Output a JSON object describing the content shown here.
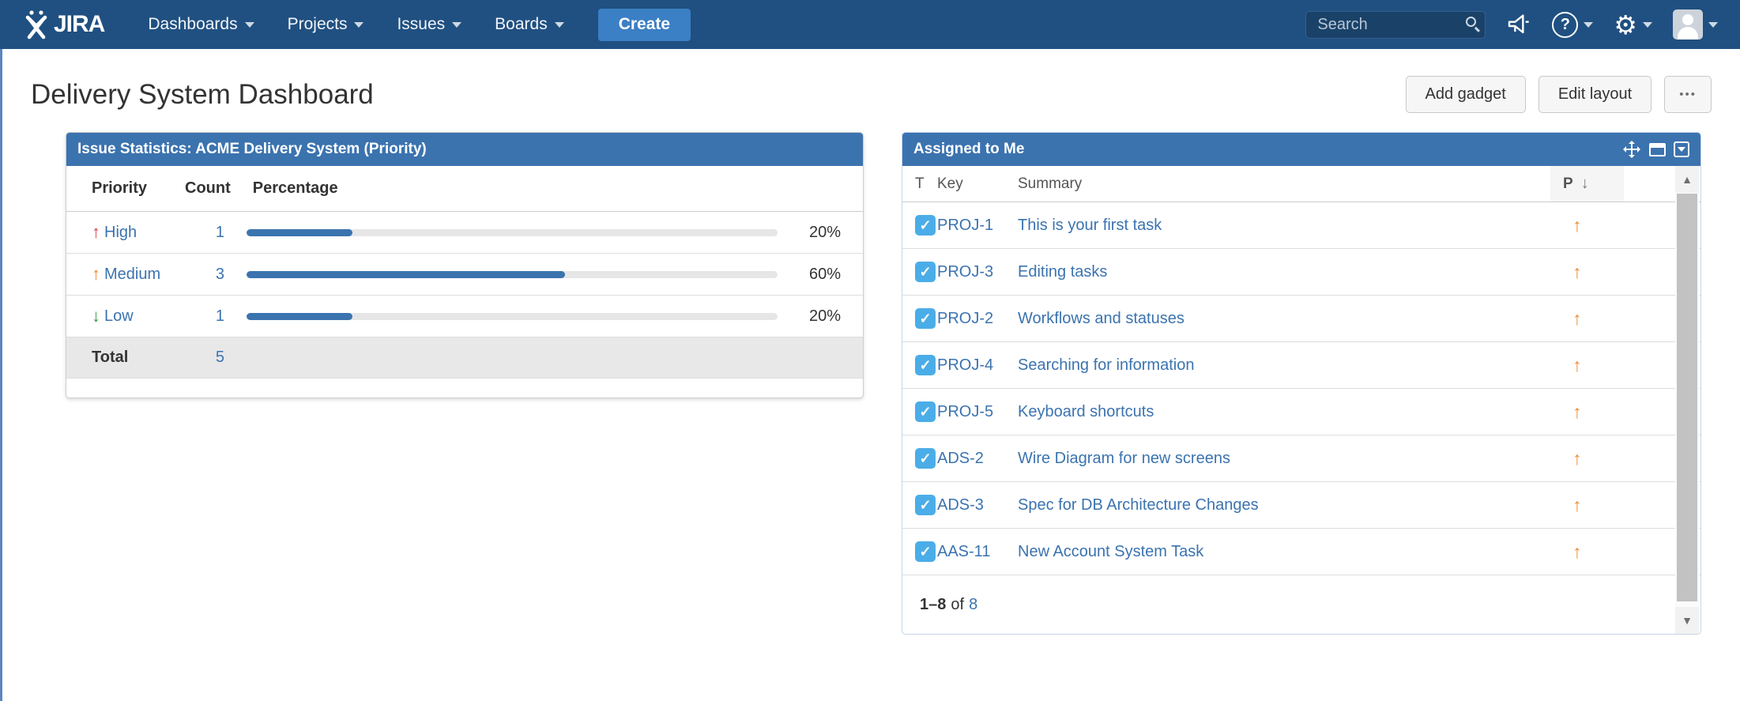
{
  "nav": {
    "logo_text": "JIRA",
    "items": [
      {
        "label": "Dashboards"
      },
      {
        "label": "Projects"
      },
      {
        "label": "Issues"
      },
      {
        "label": "Boards"
      }
    ],
    "create_label": "Create",
    "search_placeholder": "Search"
  },
  "icons": {
    "help": "?",
    "gear": "⚙",
    "check": "✓",
    "scroll_up": "▲",
    "scroll_down": "▼"
  },
  "page": {
    "title": "Delivery System Dashboard",
    "actions": {
      "add_gadget": "Add gadget",
      "edit_layout": "Edit layout",
      "more": "•••"
    }
  },
  "issue_stats": {
    "title": "Issue Statistics: ACME Delivery System (Priority)",
    "columns": [
      "Priority",
      "Count",
      "Percentage"
    ],
    "rows": [
      {
        "priority": "High",
        "arrow": "↑",
        "arrow_color": "#d5484a",
        "count": "1",
        "pct": 20,
        "pct_label": "20%"
      },
      {
        "priority": "Medium",
        "arrow": "↑",
        "arrow_color": "#ef8b31",
        "count": "3",
        "pct": 60,
        "pct_label": "60%"
      },
      {
        "priority": "Low",
        "arrow": "↓",
        "arrow_color": "#3e9b44",
        "count": "1",
        "pct": 20,
        "pct_label": "20%"
      }
    ],
    "total_label": "Total",
    "total_value": "5"
  },
  "assigned": {
    "title": "Assigned to Me",
    "columns": {
      "t": "T",
      "key": "Key",
      "summary": "Summary",
      "p": "P"
    },
    "sort_arrow": "↓",
    "rows": [
      {
        "key": "PROJ-1",
        "summary": "This is your first task",
        "priority_arrow": "↑"
      },
      {
        "key": "PROJ-3",
        "summary": "Editing tasks",
        "priority_arrow": "↑"
      },
      {
        "key": "PROJ-2",
        "summary": "Workflows and statuses",
        "priority_arrow": "↑"
      },
      {
        "key": "PROJ-4",
        "summary": "Searching for information",
        "priority_arrow": "↑"
      },
      {
        "key": "PROJ-5",
        "summary": "Keyboard shortcuts",
        "priority_arrow": "↑"
      },
      {
        "key": "ADS-2",
        "summary": "Wire Diagram for new screens",
        "priority_arrow": "↑"
      },
      {
        "key": "ADS-3",
        "summary": "Spec for DB Architecture Changes",
        "priority_arrow": "↑"
      },
      {
        "key": "AAS-11",
        "summary": "New Account System Task",
        "priority_arrow": "↑"
      }
    ],
    "pagination": {
      "range": "1–8",
      "of": "of",
      "total": "8"
    }
  },
  "colors": {
    "nav_bg": "#205081",
    "create_btn": "#3b7fc4",
    "gadget_header": "#3b73af",
    "link": "#3b73af",
    "bar_fill": "#3b73af",
    "bar_track": "#e6e6e6",
    "priority_high": "#d5484a",
    "priority_medium": "#ef8b31",
    "priority_low": "#3e9b44",
    "task_icon": "#4bade8",
    "total_row_bg": "#e8e8e8"
  }
}
